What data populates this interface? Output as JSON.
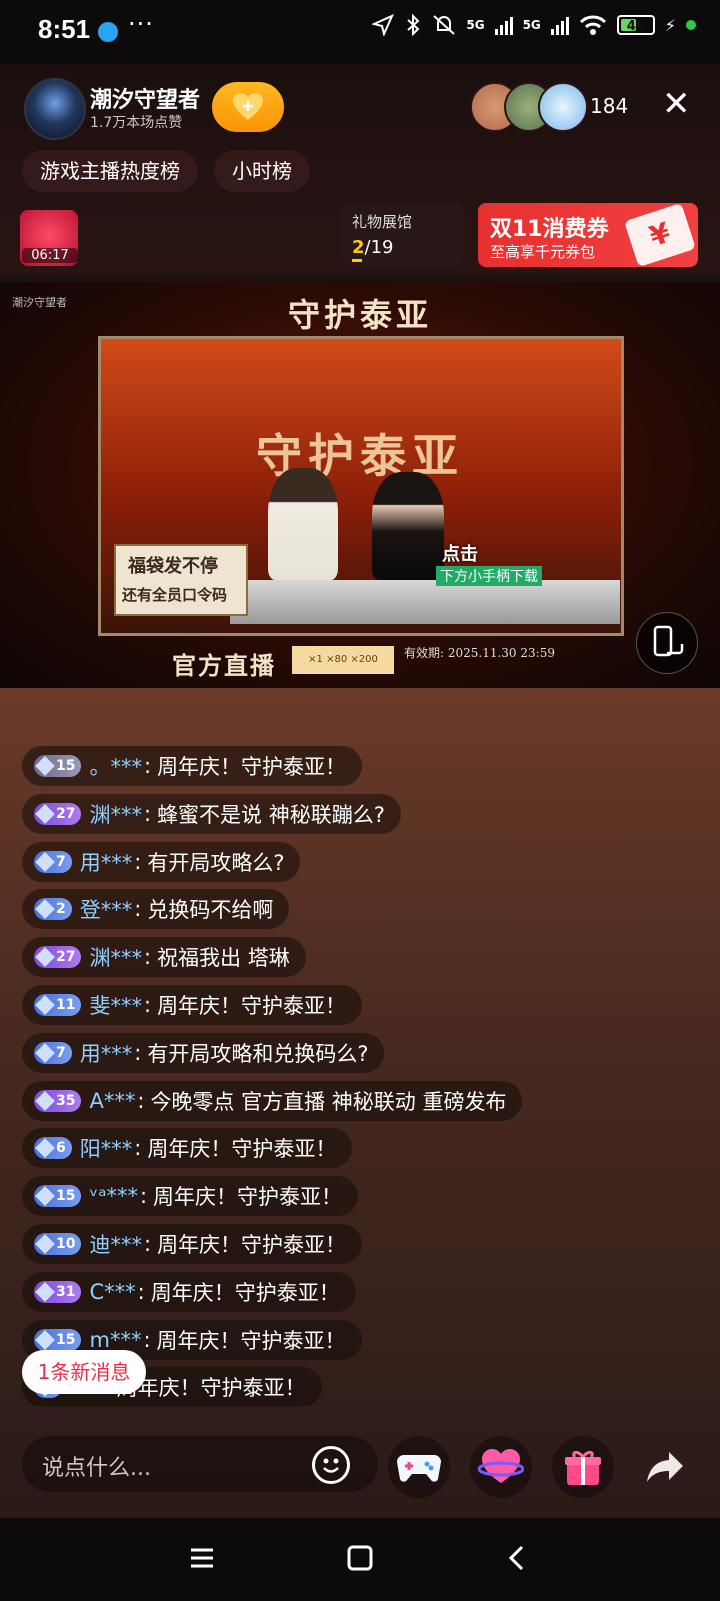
{
  "status": {
    "time": "8:51",
    "more": "···",
    "net1": "5G",
    "net2": "5G",
    "battery": "46"
  },
  "host": {
    "name": "潮汐守望者",
    "likes": "1.7万本场点赞"
  },
  "viewers": {
    "count": "184"
  },
  "ranks": [
    "游戏主播热度榜",
    "小时榜"
  ],
  "gift_bag": {
    "timer": "06:17"
  },
  "gift_hall": {
    "title": "礼物展馆",
    "current": "2",
    "total": "/19"
  },
  "coupon": {
    "title": "双11消费券",
    "subtitle": "至高享千元券包",
    "ticket": "¥"
  },
  "video": {
    "logo": "潮汐守望者",
    "banner_title": "守护泰亚",
    "screen_title": "守护泰亚",
    "sign_left_a": "福袋发不停",
    "sign_left_b": "还有全员口令码",
    "sign_right_a": "点击",
    "sign_right_b": "下方小手柄下载",
    "official": "官方直播",
    "rewards": "×1 ×80 ×200",
    "valid": "有效期: 2025.11.30 23:59"
  },
  "messages": [
    {
      "level": "15",
      "badge": "gray",
      "user": "。***",
      "text": "周年庆！守护泰亚！"
    },
    {
      "level": "27",
      "badge": "purple",
      "user": "渊***",
      "text": "蜂蜜不是说 神秘联蹦么?"
    },
    {
      "level": "7",
      "badge": "blue",
      "user": "用***",
      "text": "有开局攻略么?"
    },
    {
      "level": "2",
      "badge": "blue",
      "user": "登***",
      "text": "兑换码不给啊"
    },
    {
      "level": "27",
      "badge": "purple",
      "user": "渊***",
      "text": "祝福我出 塔琳"
    },
    {
      "level": "11",
      "badge": "blue",
      "user": "斐***",
      "text": "周年庆！守护泰亚！"
    },
    {
      "level": "7",
      "badge": "blue",
      "user": "用***",
      "text": "有开局攻略和兑换码么?"
    },
    {
      "level": "35",
      "badge": "purple",
      "user": "A***",
      "text": "今晚零点 官方直播 神秘联动 重磅发布"
    },
    {
      "level": "6",
      "badge": "blue",
      "user": "阳***",
      "text": "周年庆！守护泰亚！"
    },
    {
      "level": "15",
      "badge": "blue",
      "user": "ᵛᵃ***",
      "text": "周年庆！守护泰亚！"
    },
    {
      "level": "10",
      "badge": "blue",
      "user": "迪***",
      "text": "周年庆！守护泰亚！"
    },
    {
      "level": "31",
      "badge": "purple",
      "user": "C***",
      "text": "周年庆！守护泰亚！"
    },
    {
      "level": "15",
      "badge": "blue",
      "user": "m***",
      "text": "周年庆！守护泰亚！"
    },
    {
      "level": "",
      "badge": "blue",
      "user": "***",
      "text": "周年庆！守护泰亚！"
    }
  ],
  "new_message": "1条新消息",
  "input": {
    "placeholder": "说点什么..."
  },
  "icons": [
    "emoji-icon",
    "gamepad-icon",
    "heart-planet-icon",
    "gift-icon",
    "share-icon",
    "menu-icon",
    "home-icon",
    "back-icon",
    "rotate-screen-icon",
    "close-icon"
  ]
}
